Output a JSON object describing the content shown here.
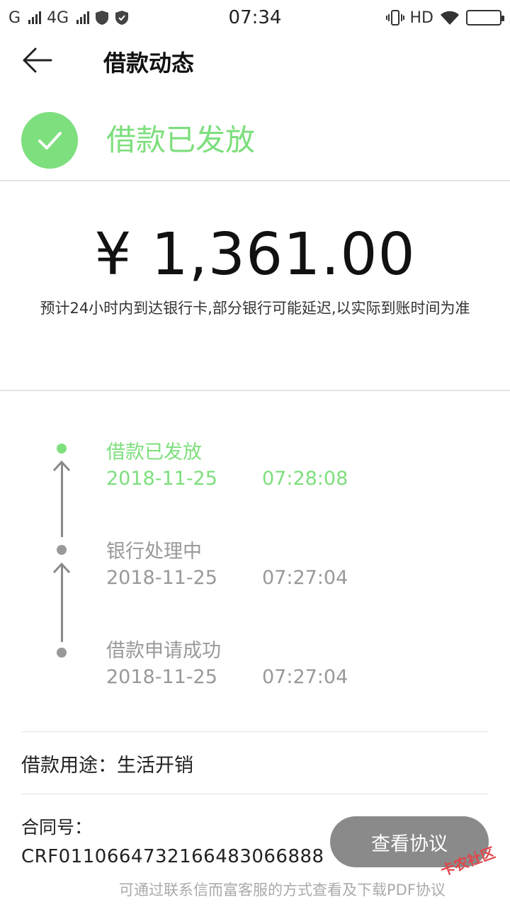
{
  "status_bar": {
    "carrier1": "G",
    "carrier2": "4G",
    "time": "07:34",
    "hd": "HD"
  },
  "header": {
    "title": "借款动态"
  },
  "status": {
    "label": "借款已发放",
    "color": "#7ddf7d"
  },
  "amount": "¥ 1,361.00",
  "notice": "预计24小时内到达银行卡,部分银行可能延迟,以实际到账时间为准",
  "timeline": [
    {
      "title": "借款已发放",
      "date": "2018-11-25",
      "time": "07:28:08",
      "active": true
    },
    {
      "title": "银行处理中",
      "date": "2018-11-25",
      "time": "07:27:04",
      "active": false
    },
    {
      "title": "借款申请成功",
      "date": "2018-11-25",
      "time": "07:27:04",
      "active": false
    }
  ],
  "details": {
    "purpose": "借款用途：生活开销",
    "contract_label": "合同号：",
    "contract_no": "CRF0110664732166483066888"
  },
  "actions": {
    "view_agreement": "查看协议"
  },
  "footnote": "可通过联系信而富客服的方式查看及下载PDF协议",
  "watermark": "卡农社区",
  "colors": {
    "accent": "#7ddf7d",
    "muted": "#999999",
    "button": "#8a8a8a"
  }
}
